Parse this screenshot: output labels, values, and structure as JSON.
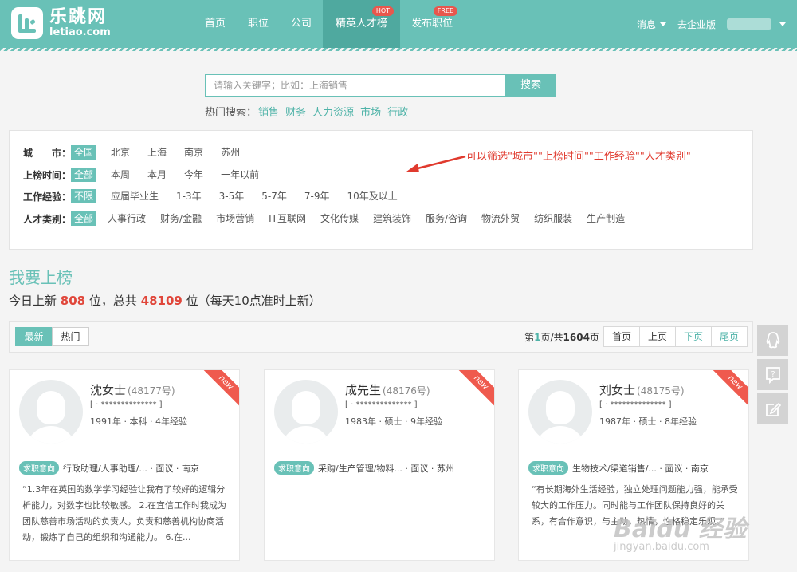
{
  "brand": {
    "name_cn": "乐跳网",
    "name_en": "letiao.com"
  },
  "nav": {
    "items": [
      {
        "label": "首页"
      },
      {
        "label": "职位"
      },
      {
        "label": "公司"
      },
      {
        "label": "精英人才榜",
        "badge": "HOT"
      },
      {
        "label": "发布职位",
        "badge": "FREE"
      }
    ],
    "messages": "消息",
    "enterprise": "去企业版"
  },
  "search": {
    "placeholder": "请输入关键字；比如：上海销售",
    "button": "搜索"
  },
  "hot_search": {
    "label": "热门搜索：",
    "items": [
      "销售",
      "财务",
      "人力资源",
      "市场",
      "行政"
    ]
  },
  "filters": {
    "city": {
      "label": "城　　市：",
      "options": [
        "全国",
        "北京",
        "上海",
        "南京",
        "苏州"
      ]
    },
    "time": {
      "label": "上榜时间：",
      "options": [
        "全部",
        "本周",
        "本月",
        "今年",
        "一年以前"
      ]
    },
    "experience": {
      "label": "工作经验：",
      "options": [
        "不限",
        "应届毕业生",
        "1-3年",
        "3-5年",
        "5-7年",
        "7-9年",
        "10年及以上"
      ]
    },
    "category": {
      "label": "人才类别：",
      "options": [
        "全部",
        "人事行政",
        "财务/金融",
        "市场营销",
        "IT互联网",
        "文化传媒",
        "建筑装饰",
        "服务/咨询",
        "物流外贸",
        "纺织服装",
        "生产制造"
      ]
    }
  },
  "annotation": "可以筛选\"城市\"\"上榜时间\"\"工作经验\"\"人才类别\"",
  "section": {
    "title": "我要上榜",
    "stats_prefix": "今日上新",
    "today_new": "808",
    "stats_mid": "位，总共",
    "total": "48109",
    "stats_suffix": "位（每天10点准时上新）"
  },
  "toolbar": {
    "tab_latest": "最新",
    "tab_hot": "热门",
    "page_prefix": "第",
    "page_current": "1",
    "page_mid": "页/共",
    "page_total": "1604",
    "page_suffix": "页",
    "first": "首页",
    "prev": "上页",
    "next": "下页",
    "last": "尾页"
  },
  "cards": [
    {
      "ribbon": "new",
      "name": "沈女士",
      "number": "(48177号)",
      "phone": "[ · ************** ]",
      "info": "1991年 · 本科 · 4年经验",
      "intent_tag": "求职意向",
      "intent": "行政助理/人事助理/... · 面议 · 南京",
      "desc": "“1.3年在英国的数学学习经验让我有了较好的逻辑分析能力，对数字也比较敏感。 2.在宜信工作时我成为团队慈善市场活动的负责人，负责和慈善机构协商活动，锻炼了自己的组织和沟通能力。 6.在..."
    },
    {
      "ribbon": "new",
      "name": "成先生",
      "number": "(48176号)",
      "phone": "[ · ************** ]",
      "info": "1983年 · 硕士 · 9年经验",
      "intent_tag": "求职意向",
      "intent": "采购/生产管理/物料... · 面议 · 苏州",
      "desc": ""
    },
    {
      "ribbon": "new",
      "name": "刘女士",
      "number": "(48175号)",
      "phone": "[ · ************** ]",
      "info": "1987年 · 硕士 · 8年经验",
      "intent_tag": "求职意向",
      "intent": "生物技术/渠道销售/... · 面议 · 南京",
      "desc": "“有长期海外生活经验，独立处理问题能力强，能承受较大的工作压力。同时能与工作团队保持良好的关系，有合作意识，与主动，热情，性格稳定乐观。”"
    }
  ],
  "watermark": {
    "line1": "Baidu 经验",
    "line2": "jingyan.baidu.com"
  },
  "side_buttons": [
    "qq-icon",
    "help-icon",
    "edit-icon"
  ]
}
